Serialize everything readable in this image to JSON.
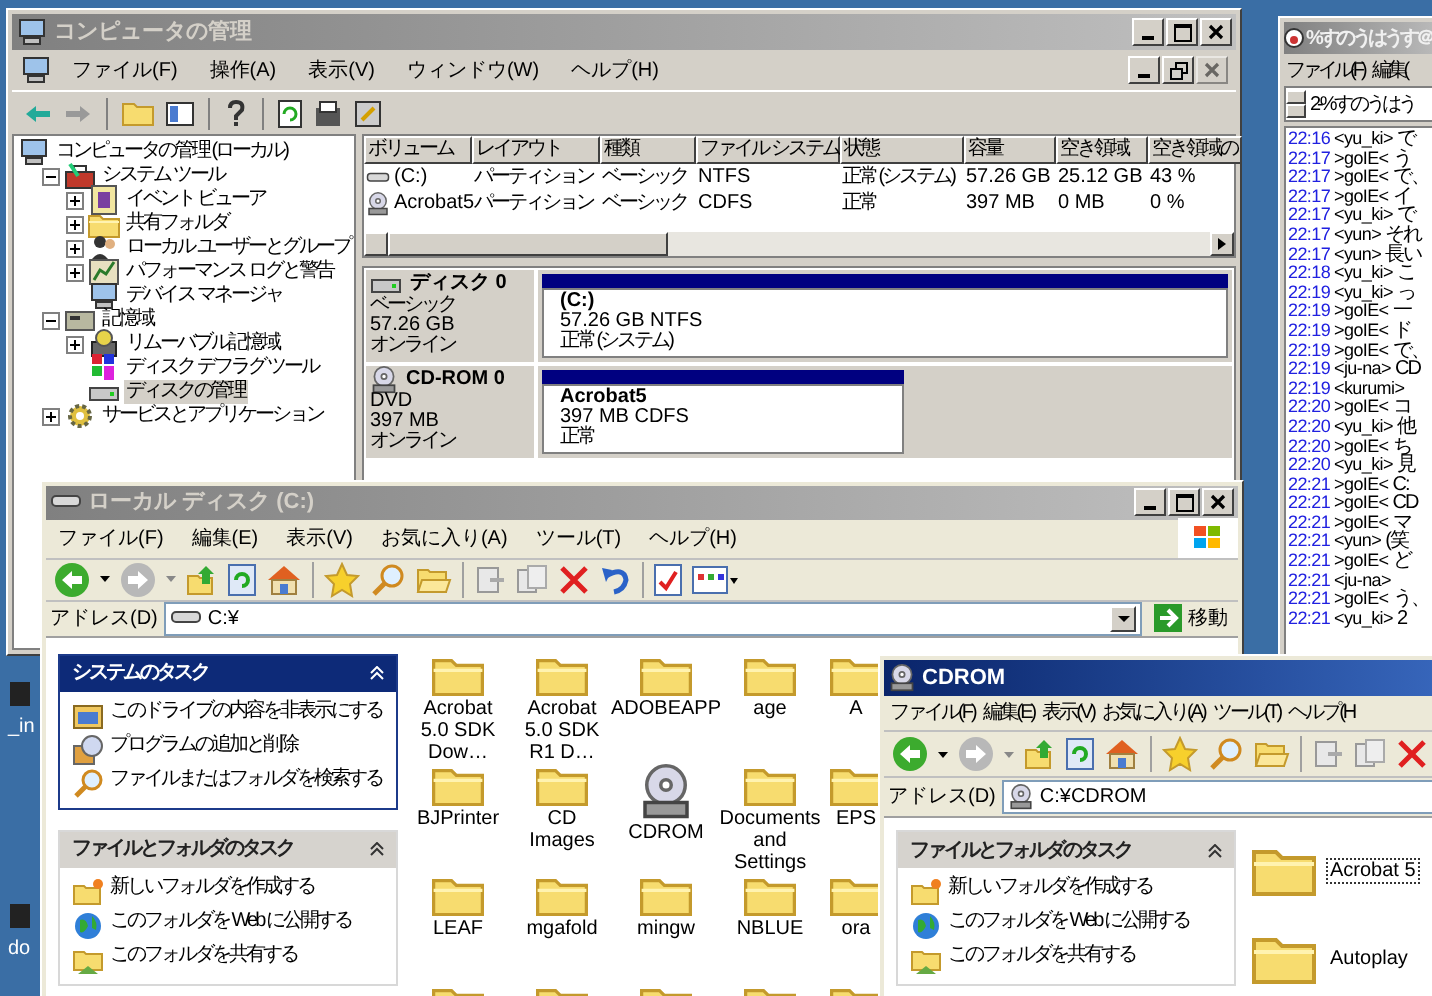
{
  "desktop_icons": [
    {
      "label": "_in"
    },
    {
      "label": "do"
    }
  ],
  "computer_management": {
    "title": "コンピュータの管理",
    "active": false,
    "menu": [
      "ファイル(F)",
      "操作(A)",
      "表示(V)",
      "ウィンドウ(W)",
      "ヘルプ(H)"
    ],
    "tree": [
      {
        "label": "コンピュータの管理 (ローカル)",
        "kind": "computer",
        "selected": false,
        "children": [
          {
            "label": "システム ツール",
            "kind": "tools",
            "expanded": true,
            "selected": false,
            "children": [
              {
                "label": "イベント ビューア",
                "kind": "event",
                "expanded": false,
                "selected": false
              },
              {
                "label": "共有フォルダ",
                "kind": "folder",
                "expanded": false,
                "selected": false
              },
              {
                "label": "ローカル ユーザーとグループ",
                "kind": "users",
                "expanded": false,
                "selected": false
              },
              {
                "label": "パフォーマンス ログと警告",
                "kind": "chart",
                "expanded": false,
                "selected": false
              },
              {
                "label": "デバイス マネージャ",
                "kind": "computer",
                "selected": false
              }
            ]
          },
          {
            "label": "記憶域",
            "kind": "storage",
            "expanded": true,
            "selected": false,
            "children": [
              {
                "label": "リムーバブル記憶域",
                "kind": "removable",
                "expanded": false,
                "selected": false
              },
              {
                "label": "ディスク デフラグ ツール",
                "kind": "defrag",
                "selected": false
              },
              {
                "label": "ディスクの管理",
                "kind": "disk",
                "selected": true
              }
            ]
          },
          {
            "label": "サービスとアプリケーション",
            "kind": "services",
            "expanded": false,
            "selected": false
          }
        ]
      }
    ],
    "volumes": {
      "columns": [
        "ボリューム",
        "レイアウト",
        "種類",
        "ファイル システム",
        "状態",
        "容量",
        "空き領域",
        "空き領域の"
      ],
      "rows": [
        {
          "kind": "drive",
          "cells": [
            "(C:)",
            "パーティション",
            "ベーシック",
            "NTFS",
            "正常 (システム)",
            "57.26 GB",
            "25.12 GB",
            "43 %"
          ]
        },
        {
          "kind": "cdrom",
          "cells": [
            "Acrobat5",
            "パーティション",
            "ベーシック",
            "CDFS",
            "正常",
            "397 MB",
            "0 MB",
            "0 %"
          ]
        }
      ]
    },
    "disks": [
      {
        "name": "ディスク 0",
        "kind": "disk",
        "lines": [
          "ベーシック",
          "57.26 GB",
          "オンライン"
        ],
        "partition": {
          "name": "(C:)",
          "lines": [
            "57.26 GB NTFS",
            "正常 (システム)"
          ]
        }
      },
      {
        "name": "CD-ROM 0",
        "kind": "cdrom",
        "lines": [
          "DVD",
          "397 MB",
          "オンライン"
        ],
        "partition": {
          "name": "Acrobat5",
          "lines": [
            "397 MB CDFS",
            "正常"
          ]
        }
      }
    ]
  },
  "chat": {
    "title": "%すのうはうす＠",
    "active": false,
    "menu": [
      "ファイル(F)",
      "編集("
    ],
    "channel": "2-%すのうはう",
    "lines": [
      {
        "time": "22:16",
        "nick": "<yu_ki>",
        "text": "で"
      },
      {
        "time": "22:17",
        "nick": ">goIE<",
        "text": "う"
      },
      {
        "time": "22:17",
        "nick": ">goIE<",
        "text": "で、"
      },
      {
        "time": "22:17",
        "nick": ">goIE<",
        "text": "イ"
      },
      {
        "time": "22:17",
        "nick": "<yu_ki>",
        "text": "で"
      },
      {
        "time": "22:17",
        "nick": "<yun>",
        "text": "それ"
      },
      {
        "time": "22:17",
        "nick": "<yun>",
        "text": "長い"
      },
      {
        "time": "22:18",
        "nick": "<yu_ki>",
        "text": "こ"
      },
      {
        "time": "22:19",
        "nick": "<yu_ki>",
        "text": "っ"
      },
      {
        "time": "22:19",
        "nick": ">goIE<",
        "text": "一"
      },
      {
        "time": "22:19",
        "nick": ">goIE<",
        "text": "ド"
      },
      {
        "time": "22:19",
        "nick": ">goIE<",
        "text": "で、"
      },
      {
        "time": "22:19",
        "nick": "<ju-na>",
        "text": "CD"
      },
      {
        "time": "22:19",
        "nick": "<kurumi>"
      },
      {
        "time": "22:20",
        "nick": ">goIE<",
        "text": "コ"
      },
      {
        "time": "22:20",
        "nick": "<yu_ki>",
        "text": "他"
      },
      {
        "time": "22:20",
        "nick": ">goIE<",
        "text": "ち"
      },
      {
        "time": "22:20",
        "nick": "<yu_ki>",
        "text": "見"
      },
      {
        "time": "22:21",
        "nick": ">goIE<",
        "text": "C:"
      },
      {
        "time": "22:21",
        "nick": ">goIE<",
        "text": "CD"
      },
      {
        "time": "22:21",
        "nick": ">goIE<",
        "text": "マ"
      },
      {
        "time": "22:21",
        "nick": "<yun>",
        "text": "(笑"
      },
      {
        "time": "22:21",
        "nick": ">goIE<",
        "text": "ど"
      },
      {
        "time": "22:21",
        "nick": "<ju-na>"
      },
      {
        "time": "22:21",
        "nick": ">goIE<",
        "text": "う、"
      },
      {
        "time": "22:21",
        "nick": "<yu_ki>",
        "text": "2"
      }
    ]
  },
  "explorer": {
    "title": "ローカル ディスク (C:)",
    "active": false,
    "menu": [
      "ファイル(F)",
      "編集(E)",
      "表示(V)",
      "お気に入り(A)",
      "ツール(T)",
      "ヘルプ(H)"
    ],
    "address_label": "アドレス(D)",
    "address": "C:¥",
    "go_button": "移動",
    "task_panes": [
      {
        "title": "システムのタスク",
        "kind": "special",
        "tasks": [
          {
            "kind": "hide",
            "label": "このドライブの内容を非表示にする"
          },
          {
            "kind": "programs",
            "label": "プログラムの追加と削除"
          },
          {
            "kind": "search",
            "label": "ファイルまたはフォルダを検索する"
          }
        ]
      },
      {
        "title": "ファイルとフォルダのタスク",
        "kind": "normal",
        "tasks": [
          {
            "kind": "new-folder",
            "label": "新しいフォルダを作成する"
          },
          {
            "kind": "web",
            "label": "このフォルダを Web に公開する"
          },
          {
            "kind": "share",
            "label": "このフォルダを共有する"
          }
        ]
      }
    ],
    "files": [
      {
        "name": "Acrobat 5.0 SDK Dow…",
        "kind": "folder",
        "selected": false
      },
      {
        "name": "Acrobat 5.0 SDK R1 D…",
        "kind": "folder",
        "selected": false
      },
      {
        "name": "ADOBEAPP",
        "kind": "folder",
        "selected": false
      },
      {
        "name": "age",
        "kind": "folder",
        "selected": false
      },
      {
        "name": "A",
        "kind": "folder",
        "selected": false
      },
      {
        "name": "BJPrinter",
        "kind": "folder",
        "selected": false
      },
      {
        "name": "CD Images",
        "kind": "folder",
        "selected": false
      },
      {
        "name": "CDROM",
        "kind": "cdrom",
        "selected": false
      },
      {
        "name": "Documents and Settings",
        "kind": "folder",
        "selected": false
      },
      {
        "name": "EPS",
        "kind": "folder",
        "selected": false
      },
      {
        "name": "LEAF",
        "kind": "folder",
        "selected": false
      },
      {
        "name": "mgafold",
        "kind": "folder",
        "selected": false
      },
      {
        "name": "mingw",
        "kind": "folder",
        "selected": false
      },
      {
        "name": "NBLUE",
        "kind": "folder",
        "selected": false
      },
      {
        "name": "ora",
        "kind": "folder",
        "selected": false
      },
      {
        "kind": "folder",
        "selected": false
      },
      {
        "kind": "folder",
        "selected": false
      },
      {
        "kind": "folder",
        "selected": false
      },
      {
        "kind": "folder",
        "selected": false
      },
      {
        "kind": "folder",
        "selected": false
      }
    ]
  },
  "cdrom": {
    "title": "CDROM",
    "active": true,
    "menu": [
      "ファイル(F)",
      "編集(E)",
      "表示(V)",
      "お気に入り(A)",
      "ツール(T)",
      "ヘルプ(H"
    ],
    "address_label": "アドレス(D)",
    "address": "C:¥CDROM",
    "task_panes": [
      {
        "title": "ファイルとフォルダのタスク",
        "kind": "normal",
        "tasks": [
          {
            "kind": "new-folder",
            "label": "新しいフォルダを作成する"
          },
          {
            "kind": "web",
            "label": "このフォルダを Web に公開する"
          },
          {
            "kind": "share",
            "label": "このフォルダを共有する"
          }
        ]
      }
    ],
    "files": [
      {
        "name": "Acrobat 5",
        "kind": "folder",
        "selected": true
      },
      {
        "name": "Autoplay",
        "kind": "folder",
        "selected": false
      }
    ]
  }
}
